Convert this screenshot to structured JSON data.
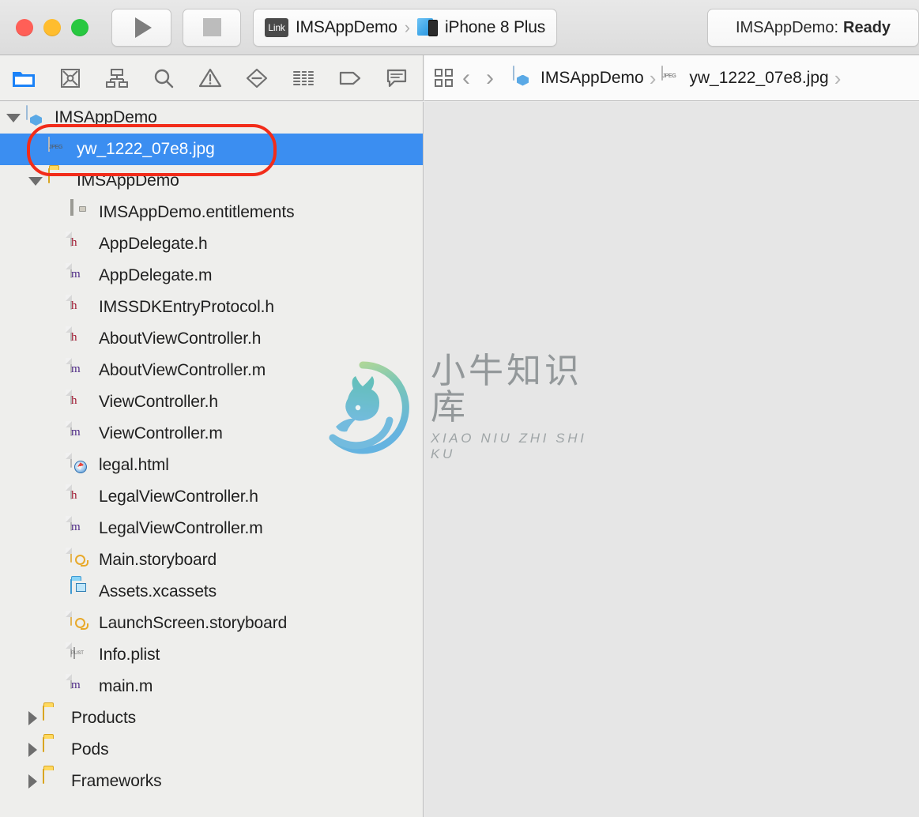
{
  "window": {
    "traffic_lights": [
      {
        "name": "close",
        "color": "#ff5f57"
      },
      {
        "name": "minimize",
        "color": "#ffbd2e"
      },
      {
        "name": "zoom",
        "color": "#28c840"
      }
    ]
  },
  "toolbar": {
    "run_label": "Run",
    "stop_label": "Stop",
    "scheme": {
      "badge": "Link",
      "name": "IMSAppDemo",
      "separator": "›",
      "destination": "iPhone 8 Plus"
    },
    "status": {
      "prefix": "IMSAppDemo:",
      "state": "Ready"
    }
  },
  "navigator_tabs": [
    {
      "name": "project-navigator",
      "icon": "folder-icon",
      "selected": true
    },
    {
      "name": "source-control-navigator",
      "icon": "source-control-icon",
      "selected": false
    },
    {
      "name": "symbol-navigator",
      "icon": "hierarchy-icon",
      "selected": false
    },
    {
      "name": "find-navigator",
      "icon": "search-icon",
      "selected": false
    },
    {
      "name": "issue-navigator",
      "icon": "warning-triangle-icon",
      "selected": false
    },
    {
      "name": "test-navigator",
      "icon": "diamond-minus-icon",
      "selected": false
    },
    {
      "name": "report-navigator",
      "icon": "list-lines-icon",
      "selected": false
    },
    {
      "name": "breakpoint-navigator",
      "icon": "tag-icon",
      "selected": false
    },
    {
      "name": "debug-navigator",
      "icon": "speech-bubble-icon",
      "selected": false
    }
  ],
  "jumpbar": {
    "grid_icon": "related-items-icon",
    "back": "‹",
    "forward": "›",
    "separator": "›",
    "crumbs": [
      {
        "label": "IMSAppDemo",
        "icon": "xcode-project-icon"
      },
      {
        "label": "yw_1222_07e8.jpg",
        "icon": "jpeg-file-icon"
      }
    ]
  },
  "navigator": {
    "rows": [
      {
        "label": "IMSAppDemo",
        "indent": 0,
        "disclosure": "open",
        "icon": "xcode-project-icon",
        "selected": false
      },
      {
        "label": "yw_1222_07e8.jpg",
        "indent": 1,
        "disclosure": "none",
        "icon": "jpeg-file-icon",
        "selected": true
      },
      {
        "label": "IMSAppDemo",
        "indent": 1,
        "disclosure": "open",
        "icon": "folder-yellow-icon",
        "selected": false
      },
      {
        "label": "IMSAppDemo.entitlements",
        "indent": 2,
        "disclosure": "none",
        "icon": "entitlements-icon",
        "selected": false
      },
      {
        "label": "AppDelegate.h",
        "indent": 2,
        "disclosure": "none",
        "icon": "header-file-icon",
        "selected": false
      },
      {
        "label": "AppDelegate.m",
        "indent": 2,
        "disclosure": "none",
        "icon": "objc-file-icon",
        "selected": false
      },
      {
        "label": "IMSSDKEntryProtocol.h",
        "indent": 2,
        "disclosure": "none",
        "icon": "header-file-icon",
        "selected": false
      },
      {
        "label": "AboutViewController.h",
        "indent": 2,
        "disclosure": "none",
        "icon": "header-file-icon",
        "selected": false
      },
      {
        "label": "AboutViewController.m",
        "indent": 2,
        "disclosure": "none",
        "icon": "objc-file-icon",
        "selected": false
      },
      {
        "label": "ViewController.h",
        "indent": 2,
        "disclosure": "none",
        "icon": "header-file-icon",
        "selected": false
      },
      {
        "label": "ViewController.m",
        "indent": 2,
        "disclosure": "none",
        "icon": "objc-file-icon",
        "selected": false
      },
      {
        "label": "legal.html",
        "indent": 2,
        "disclosure": "none",
        "icon": "html-file-icon",
        "selected": false
      },
      {
        "label": "LegalViewController.h",
        "indent": 2,
        "disclosure": "none",
        "icon": "header-file-icon",
        "selected": false
      },
      {
        "label": "LegalViewController.m",
        "indent": 2,
        "disclosure": "none",
        "icon": "objc-file-icon",
        "selected": false
      },
      {
        "label": "Main.storyboard",
        "indent": 2,
        "disclosure": "none",
        "icon": "storyboard-icon",
        "selected": false
      },
      {
        "label": "Assets.xcassets",
        "indent": 2,
        "disclosure": "none",
        "icon": "assets-folder-icon",
        "selected": false
      },
      {
        "label": "LaunchScreen.storyboard",
        "indent": 2,
        "disclosure": "none",
        "icon": "storyboard-icon",
        "selected": false
      },
      {
        "label": "Info.plist",
        "indent": 2,
        "disclosure": "none",
        "icon": "plist-icon",
        "selected": false
      },
      {
        "label": "main.m",
        "indent": 2,
        "disclosure": "none",
        "icon": "objc-file-icon",
        "selected": false
      },
      {
        "label": "Products",
        "indent": 1,
        "disclosure": "closed",
        "icon": "folder-yellow-icon",
        "selected": false
      },
      {
        "label": "Pods",
        "indent": 1,
        "disclosure": "closed",
        "icon": "folder-yellow-icon",
        "selected": false
      },
      {
        "label": "Frameworks",
        "indent": 1,
        "disclosure": "closed",
        "icon": "folder-yellow-icon",
        "selected": false
      }
    ]
  },
  "watermark": {
    "cn": "小牛知识库",
    "en": "XIAO NIU ZHI SHI KU"
  },
  "annotation": {
    "shape": "ellipse-highlight",
    "color": "#f22c1a",
    "targets": "yw_1222_07e8.jpg"
  },
  "colors": {
    "selection_blue": "#3b8ef1",
    "annotation_red": "#f22c1a",
    "navigator_bg": "#eeeeec",
    "editor_bg": "#e6e6e6"
  }
}
